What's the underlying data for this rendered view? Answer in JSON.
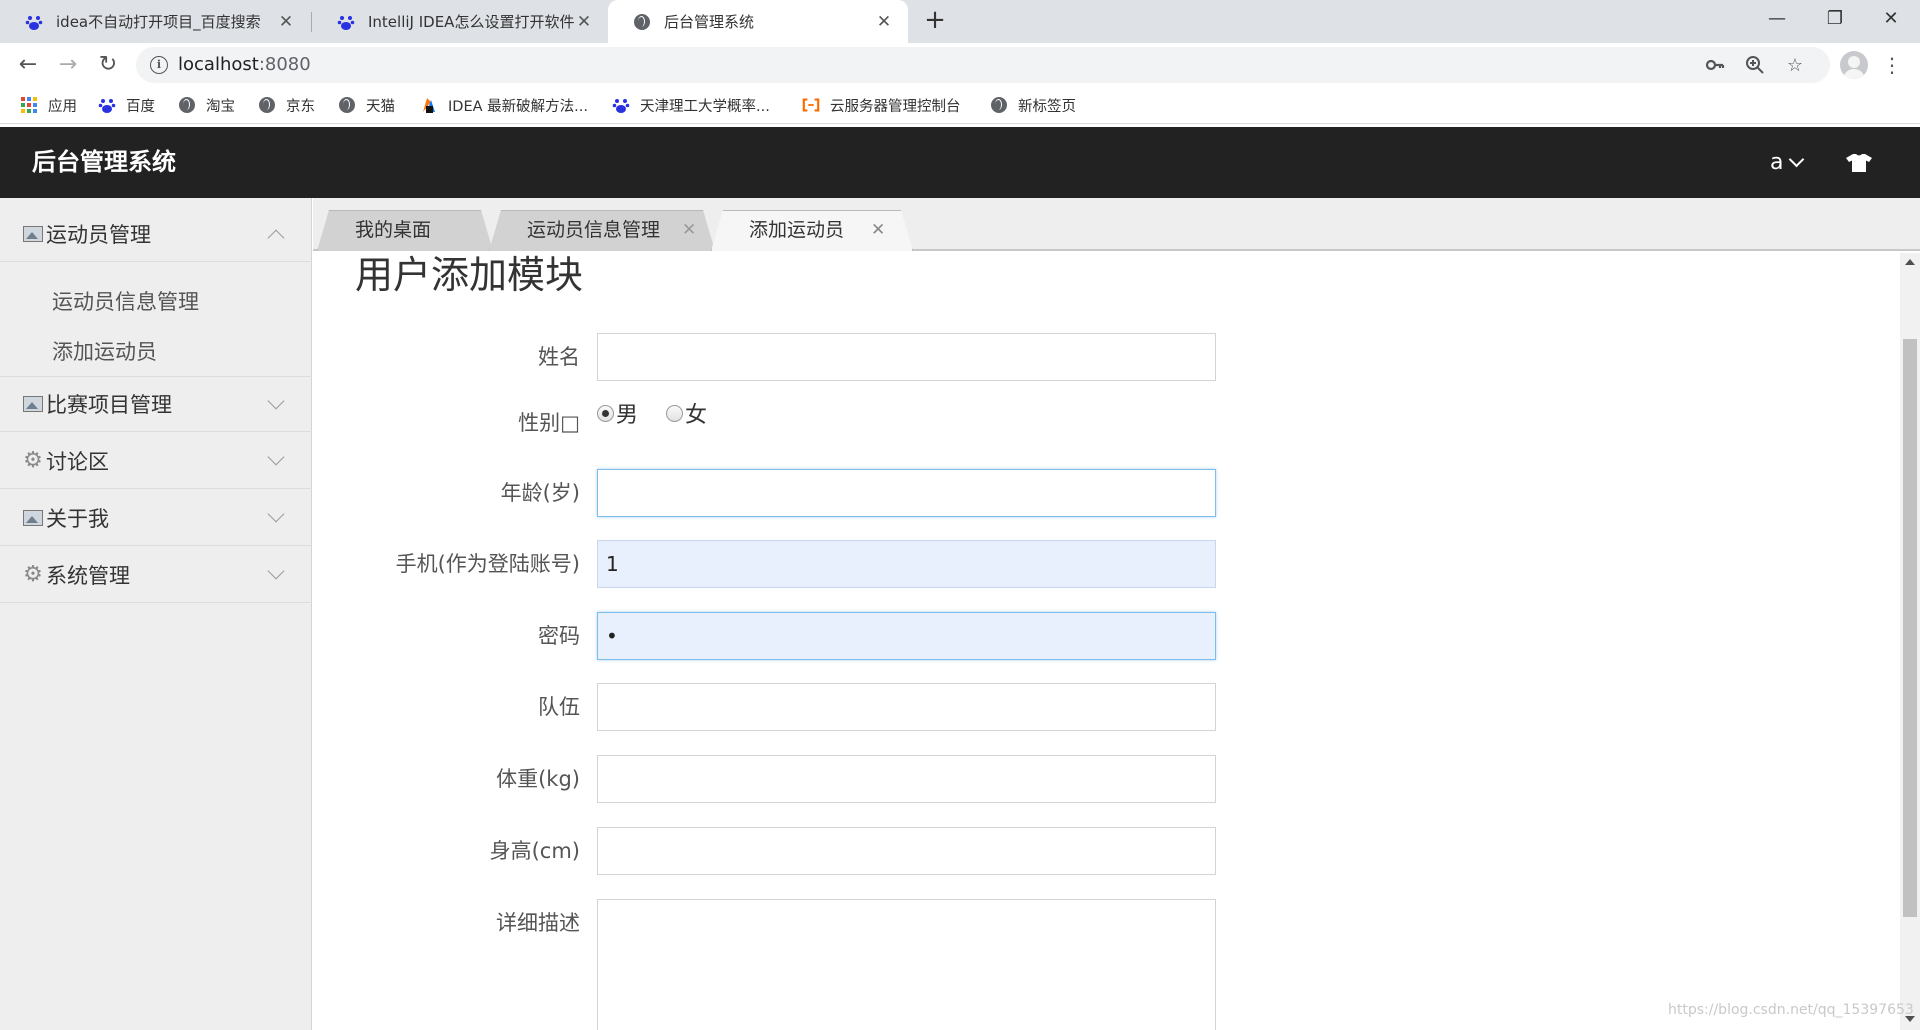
{
  "browser": {
    "tabs": [
      {
        "title": "idea不自动打开项目_百度搜索",
        "icon": "baidu-paw-icon"
      },
      {
        "title": "IntelliJ IDEA怎么设置打开软件不",
        "icon": "baidu-paw-icon"
      },
      {
        "title": "后台管理系统",
        "icon": "globe-icon"
      }
    ],
    "new_tab": "+",
    "window": {
      "minimize": "—",
      "restore": "❐",
      "close": "✕"
    },
    "address": {
      "host": "localhost",
      "port": ":8080"
    },
    "bookmarks": [
      {
        "label": "应用",
        "icon": "apps-grid-icon"
      },
      {
        "label": "百度",
        "icon": "baidu-paw-icon"
      },
      {
        "label": "淘宝",
        "icon": "globe-icon"
      },
      {
        "label": "京东",
        "icon": "globe-icon"
      },
      {
        "label": "天猫",
        "icon": "globe-icon"
      },
      {
        "label": "IDEA 最新破解方法...",
        "icon": "idea-logo-icon"
      },
      {
        "label": "天津理工大学概率...",
        "icon": "baidu-paw-icon"
      },
      {
        "label": "云服务器管理控制台",
        "icon": "aliyun-icon"
      },
      {
        "label": "新标签页",
        "icon": "globe-icon"
      }
    ]
  },
  "app": {
    "title": "后台管理系统",
    "user": "a"
  },
  "sidebar": {
    "groups": [
      {
        "label": "运动员管理",
        "icon": "picture-icon",
        "expanded": true,
        "items": [
          "运动员信息管理",
          "添加运动员"
        ]
      },
      {
        "label": "比赛项目管理",
        "icon": "picture-icon",
        "expanded": false
      },
      {
        "label": "讨论区",
        "icon": "gear-icon",
        "expanded": false
      },
      {
        "label": "关于我",
        "icon": "picture-icon",
        "expanded": false
      },
      {
        "label": "系统管理",
        "icon": "gear-icon",
        "expanded": false
      }
    ]
  },
  "page_tabs": [
    {
      "label": "我的桌面",
      "closable": false,
      "active": false
    },
    {
      "label": "运动员信息管理",
      "closable": true,
      "active": false
    },
    {
      "label": "添加运动员",
      "closable": true,
      "active": true
    }
  ],
  "form": {
    "title": "用户添加模块",
    "name_label": "姓名",
    "name_value": "",
    "gender_label": "性别□",
    "gender_options": [
      "男",
      "女"
    ],
    "gender_selected": "男",
    "age_label": "年龄(岁)",
    "age_value": "",
    "phone_label": "手机(作为登陆账号)",
    "phone_value": "1",
    "password_label": "密码",
    "password_value": "•",
    "team_label": "队伍",
    "team_value": "",
    "weight_label": "体重(kg)",
    "weight_value": "",
    "height_label": "身高(cm)",
    "height_value": "",
    "description_label": "详细描述",
    "description_value": ""
  },
  "watermark": "https://blog.csdn.net/qq_15397653",
  "colors": {
    "header_bg": "#222222",
    "sidebar_bg": "#eeeeee",
    "focus_border": "#7dbde8",
    "autofill_bg": "#e8f0fe"
  }
}
